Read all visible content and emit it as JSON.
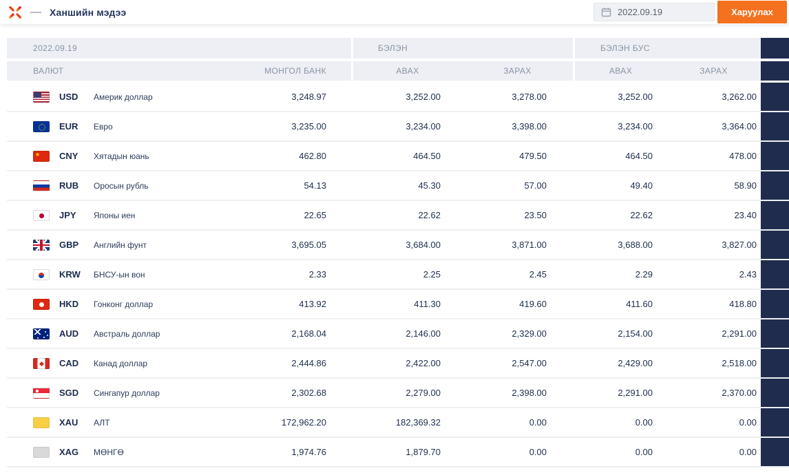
{
  "topbar": {
    "title": "Ханшийн мэдээ",
    "date_value": "2022.09.19",
    "show_button": "Харуулах",
    "icons": {
      "logo": "starburst-bank-logo",
      "calendar": "calendar-icon"
    }
  },
  "colors": {
    "accent_orange": "#f4711f",
    "navy_text": "#20304f",
    "header_bg": "#edeff4",
    "header_text": "#8a92a6",
    "right_rail": "#202c4e"
  },
  "table": {
    "group_headers": {
      "date": "2022.09.19",
      "cash": "БЭЛЭН",
      "noncash": "БЭЛЭН БУС"
    },
    "columns": {
      "currency": "ВАЛЮТ",
      "mongol_bank": "МОНГОЛ БАНК",
      "cash_buy": "АВАХ",
      "cash_sell": "ЗАРАХ",
      "noncash_buy": "АВАХ",
      "noncash_sell": "ЗАРАХ"
    },
    "rows": [
      {
        "flag": "usd",
        "code": "USD",
        "name": "Америк доллар",
        "mongol_bank": "3,248.97",
        "cash_buy": "3,252.00",
        "cash_sell": "3,278.00",
        "noncash_buy": "3,252.00",
        "noncash_sell": "3,262.00"
      },
      {
        "flag": "eur",
        "code": "EUR",
        "name": "Евро",
        "mongol_bank": "3,235.00",
        "cash_buy": "3,234.00",
        "cash_sell": "3,398.00",
        "noncash_buy": "3,234.00",
        "noncash_sell": "3,364.00"
      },
      {
        "flag": "cny",
        "code": "CNY",
        "name": "Хятадын юань",
        "mongol_bank": "462.80",
        "cash_buy": "464.50",
        "cash_sell": "479.50",
        "noncash_buy": "464.50",
        "noncash_sell": "478.00"
      },
      {
        "flag": "rub",
        "code": "RUB",
        "name": "Оросын рубль",
        "mongol_bank": "54.13",
        "cash_buy": "45.30",
        "cash_sell": "57.00",
        "noncash_buy": "49.40",
        "noncash_sell": "58.90"
      },
      {
        "flag": "jpy",
        "code": "JPY",
        "name": "Японы иен",
        "mongol_bank": "22.65",
        "cash_buy": "22.62",
        "cash_sell": "23.50",
        "noncash_buy": "22.62",
        "noncash_sell": "23.40"
      },
      {
        "flag": "gbp",
        "code": "GBP",
        "name": "Английн фунт",
        "mongol_bank": "3,695.05",
        "cash_buy": "3,684.00",
        "cash_sell": "3,871.00",
        "noncash_buy": "3,688.00",
        "noncash_sell": "3,827.00"
      },
      {
        "flag": "krw",
        "code": "KRW",
        "name": "БНСУ-ын вон",
        "mongol_bank": "2.33",
        "cash_buy": "2.25",
        "cash_sell": "2.45",
        "noncash_buy": "2.29",
        "noncash_sell": "2.43"
      },
      {
        "flag": "hkd",
        "code": "HKD",
        "name": "Гонконг доллар",
        "mongol_bank": "413.92",
        "cash_buy": "411.30",
        "cash_sell": "419.60",
        "noncash_buy": "411.60",
        "noncash_sell": "418.80"
      },
      {
        "flag": "aud",
        "code": "AUD",
        "name": "Австраль доллар",
        "mongol_bank": "2,168.04",
        "cash_buy": "2,146.00",
        "cash_sell": "2,329.00",
        "noncash_buy": "2,154.00",
        "noncash_sell": "2,291.00"
      },
      {
        "flag": "cad",
        "code": "CAD",
        "name": "Канад доллар",
        "mongol_bank": "2,444.86",
        "cash_buy": "2,422.00",
        "cash_sell": "2,547.00",
        "noncash_buy": "2,429.00",
        "noncash_sell": "2,518.00"
      },
      {
        "flag": "sgd",
        "code": "SGD",
        "name": "Сингапур доллар",
        "mongol_bank": "2,302.68",
        "cash_buy": "2,279.00",
        "cash_sell": "2,398.00",
        "noncash_buy": "2,291.00",
        "noncash_sell": "2,370.00"
      },
      {
        "flag": "xau",
        "code": "XAU",
        "name": "АЛТ",
        "mongol_bank": "172,962.20",
        "cash_buy": "182,369.32",
        "cash_sell": "0.00",
        "noncash_buy": "0.00",
        "noncash_sell": "0.00"
      },
      {
        "flag": "xag",
        "code": "XAG",
        "name": "МӨНГӨ",
        "mongol_bank": "1,974.76",
        "cash_buy": "1,879.70",
        "cash_sell": "0.00",
        "noncash_buy": "0.00",
        "noncash_sell": "0.00"
      }
    ]
  }
}
